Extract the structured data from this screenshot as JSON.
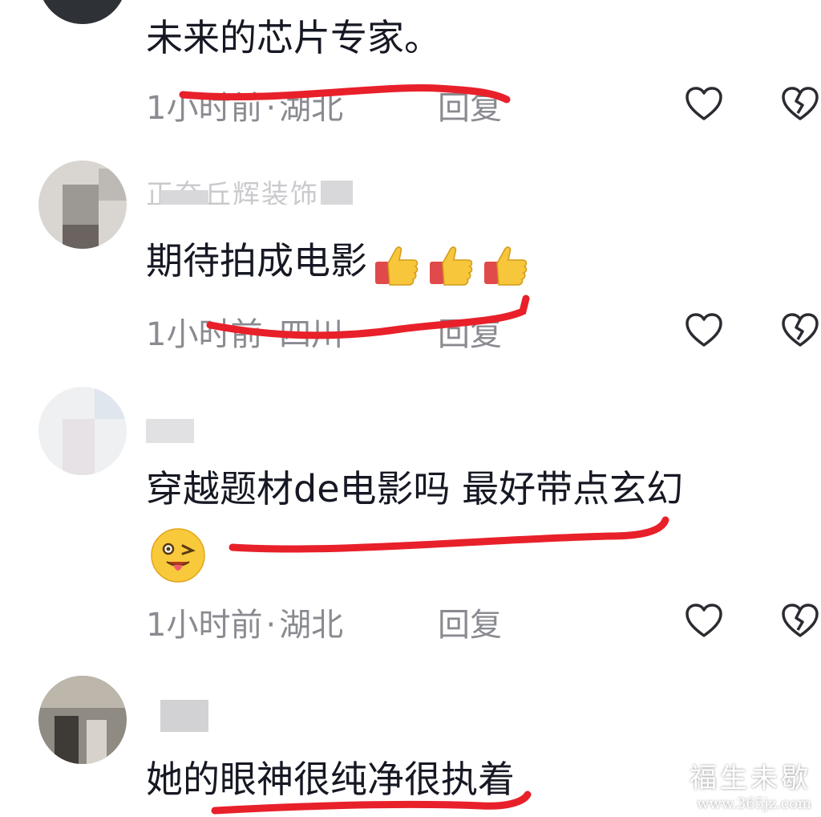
{
  "comments": [
    {
      "username": "",
      "text": "未来的芯片专家。",
      "time": "1小时前",
      "separator": "·",
      "location": "湖北",
      "reply_label": "回复"
    },
    {
      "username": "正奈丘辉装饰",
      "text": "期待拍成电影",
      "emojis": [
        "thumbs-up",
        "thumbs-up",
        "thumbs-up"
      ],
      "time": "1小时前",
      "separator": "·",
      "location": "四川",
      "reply_label": "回复"
    },
    {
      "username": "",
      "text": "穿越题材de电影吗 最好带点玄幻",
      "emojis": [
        "winking-tongue-face"
      ],
      "time": "1小时前",
      "separator": "·",
      "location": "湖北",
      "reply_label": "回复"
    },
    {
      "username": "",
      "text": "她的眼神很纯净很执着"
    }
  ],
  "icons": {
    "like": "heart-outline-icon",
    "dislike": "broken-heart-outline-icon"
  },
  "annotation_color": "#e8202a",
  "watermark": {
    "line1": "福生未歇",
    "line2": "www.365jz.com"
  }
}
